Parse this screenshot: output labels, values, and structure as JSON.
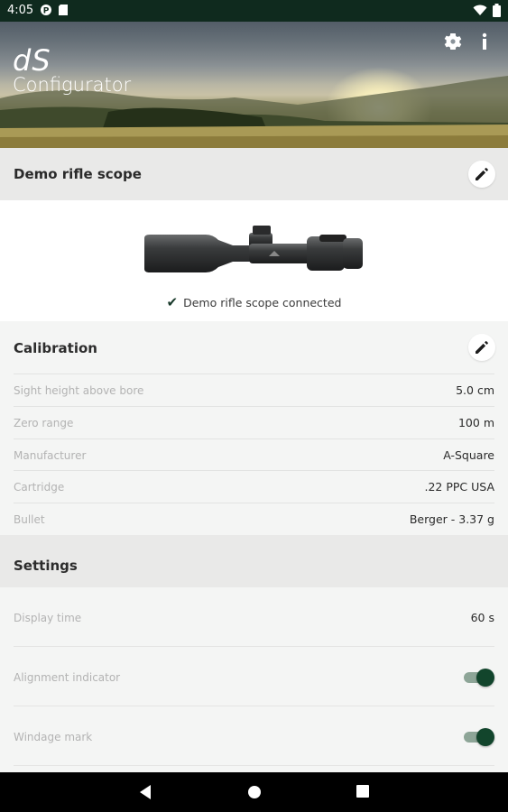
{
  "status_bar": {
    "time": "4:05",
    "icons_left": [
      "notification-p-icon",
      "sd-card-icon"
    ],
    "icons_right": [
      "wifi-icon",
      "battery-icon"
    ]
  },
  "header": {
    "logo_prefix": "dS",
    "app_title": "Configurator",
    "settings_icon": "gear-icon",
    "info_icon": "info-icon"
  },
  "device": {
    "title": "Demo rifle scope",
    "status": "Demo rifle scope connected"
  },
  "calibration": {
    "title": "Calibration",
    "rows": [
      {
        "label": "Sight height above bore",
        "value": "5.0 cm"
      },
      {
        "label": "Zero range",
        "value": "100 m"
      },
      {
        "label": "Manufacturer",
        "value": "A-Square"
      },
      {
        "label": "Cartridge",
        "value": ".22 PPC USA"
      },
      {
        "label": "Bullet",
        "value": "Berger - 3.37 g"
      }
    ]
  },
  "settings": {
    "title": "Settings",
    "display_time": {
      "label": "Display time",
      "value": "60 s"
    },
    "alignment_indicator": {
      "label": "Alignment indicator",
      "enabled": true
    },
    "windage_mark": {
      "label": "Windage mark",
      "enabled": true
    }
  },
  "colors": {
    "accent": "#12452c",
    "status_bar": "#0f2a1e",
    "section_header": "#e9e9e8"
  }
}
